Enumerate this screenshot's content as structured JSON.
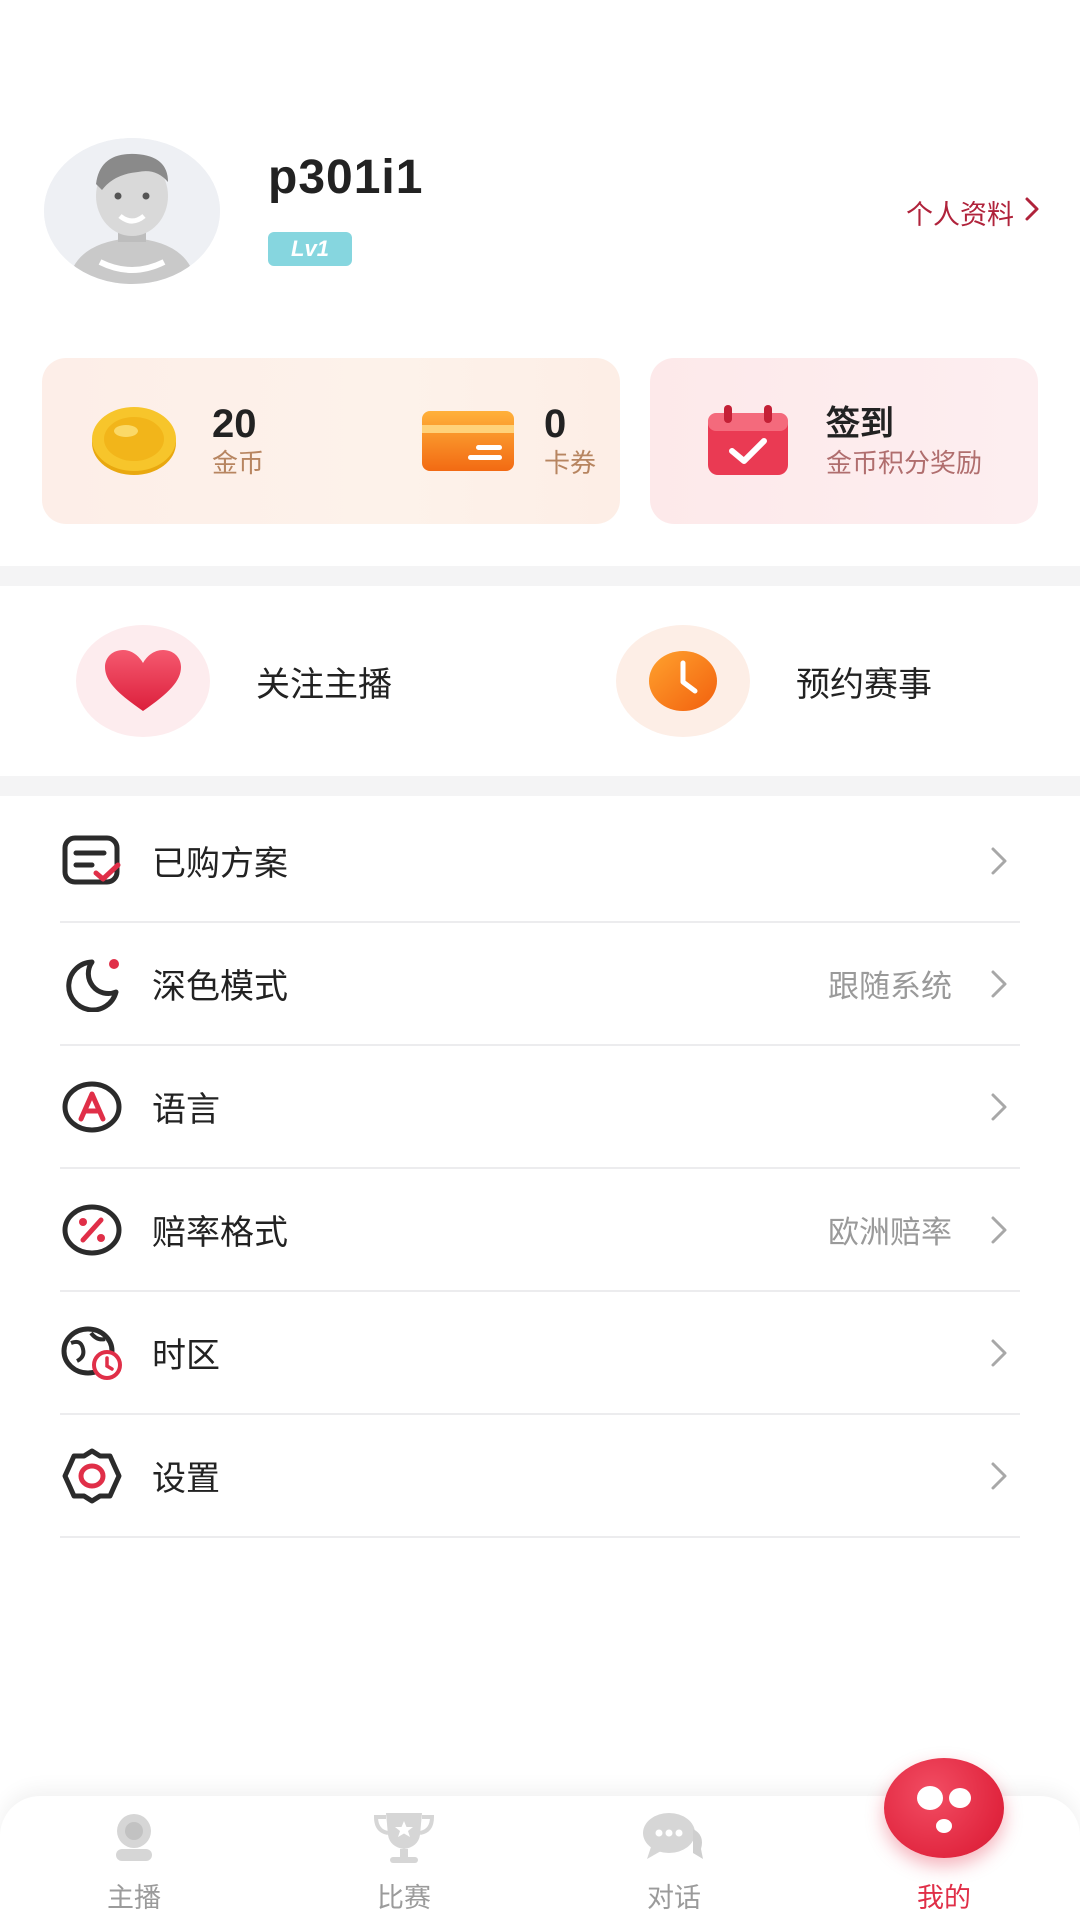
{
  "profile": {
    "username": "p301i1",
    "level": "Lv1",
    "profile_link": "个人资料"
  },
  "wallet": {
    "coins": {
      "value": "20",
      "label": "金币",
      "icon": "gold-coin-icon"
    },
    "coupons": {
      "value": "0",
      "label": "卡券",
      "icon": "card-coupon-icon"
    }
  },
  "signin": {
    "title": "签到",
    "subtitle": "金币积分奖励",
    "icon": "calendar-check-icon"
  },
  "quick_actions": [
    {
      "label": "关注主播",
      "icon": "heart-icon"
    },
    {
      "label": "预约赛事",
      "icon": "clock-icon"
    }
  ],
  "menu": [
    {
      "label": "已购方案",
      "value": "",
      "icon": "purchased-plan-icon"
    },
    {
      "label": "深色模式",
      "value": "跟随系统",
      "icon": "moon-icon"
    },
    {
      "label": "语言",
      "value": "",
      "icon": "language-icon"
    },
    {
      "label": "赔率格式",
      "value": "欧洲赔率",
      "icon": "percent-icon"
    },
    {
      "label": "时区",
      "value": "",
      "icon": "timezone-icon"
    },
    {
      "label": "设置",
      "value": "",
      "icon": "gear-icon"
    }
  ],
  "tabs": [
    {
      "label": "主播",
      "icon": "streamer-icon",
      "active": false
    },
    {
      "label": "比赛",
      "icon": "trophy-icon",
      "active": false
    },
    {
      "label": "对话",
      "icon": "chat-icon",
      "active": false
    },
    {
      "label": "我的",
      "icon": "profile-face-icon",
      "active": true
    }
  ],
  "colors": {
    "accent": "#e02f48",
    "profile_link": "#b0233b",
    "level_badge": "#86d6df",
    "wallet_label": "#b78560",
    "muted_value": "#9a9a9a"
  }
}
